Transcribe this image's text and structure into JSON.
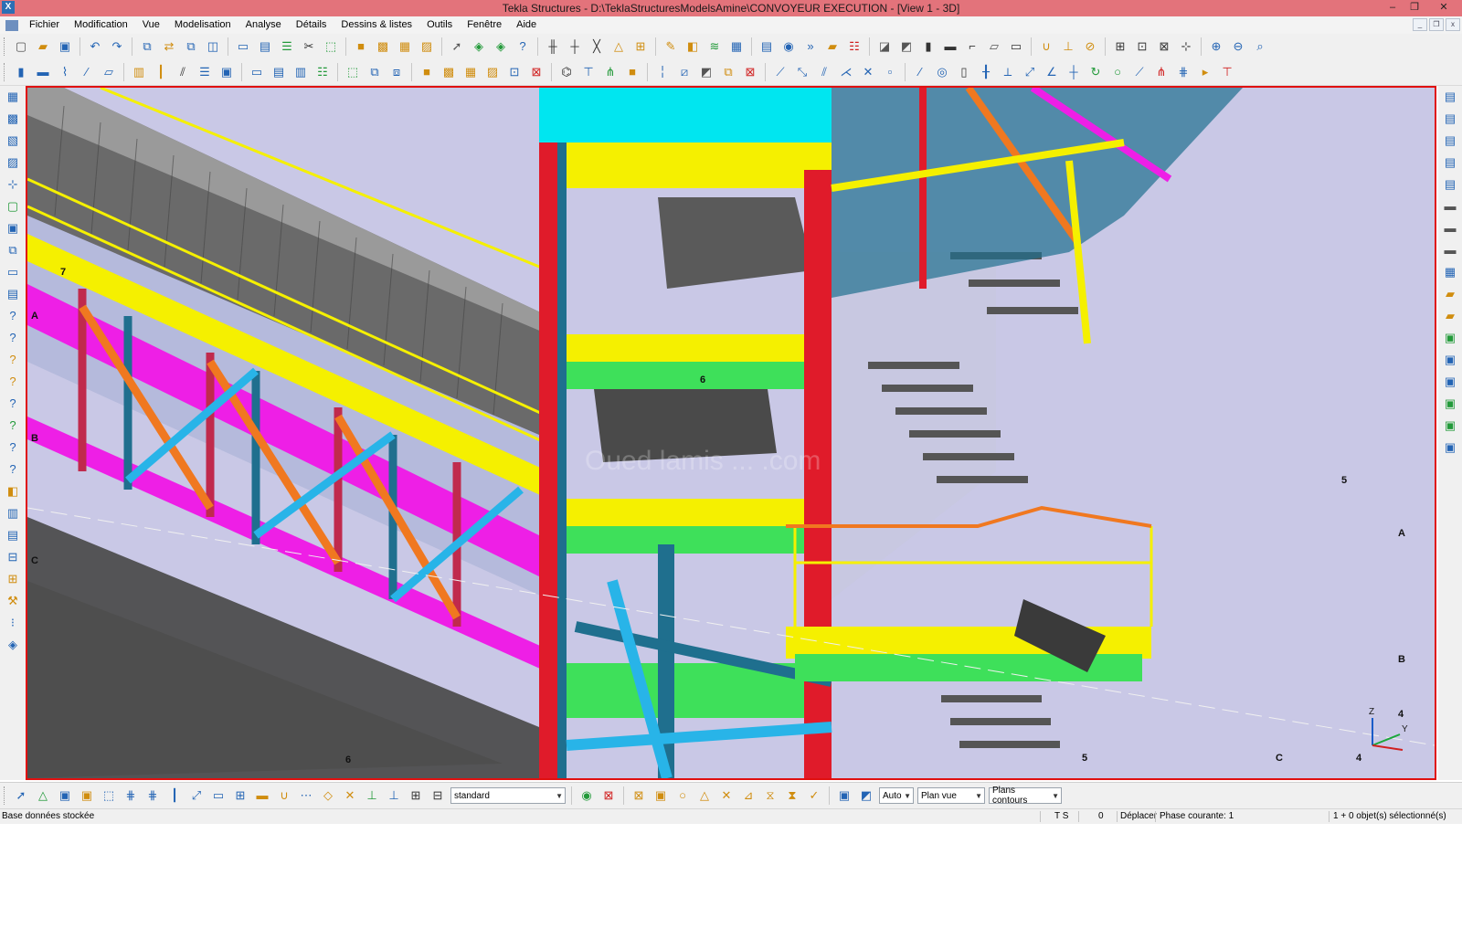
{
  "window": {
    "title": "Tekla Structures - D:\\TeklaStructuresModelsAmine\\CONVOYEUR EXECUTION - [View 1 - 3D]",
    "controls": [
      "–",
      "❐",
      "✕"
    ]
  },
  "menu": {
    "items": [
      "Fichier",
      "Modification",
      "Vue",
      "Modelisation",
      "Analyse",
      "Détails",
      "Dessins & listes",
      "Outils",
      "Fenêtre",
      "Aide"
    ]
  },
  "viewport": {
    "border_color": "#e01010",
    "background": "#c9c8e6",
    "watermark": "Oued lamis ... .com",
    "grid_labels": [
      {
        "id": "gl-7",
        "text": "7"
      },
      {
        "id": "gl-a-left",
        "text": "A"
      },
      {
        "id": "gl-b-left",
        "text": "B"
      },
      {
        "id": "gl-c-left",
        "text": "C"
      },
      {
        "id": "gl-6-top",
        "text": "6"
      },
      {
        "id": "gl-6-bottom",
        "text": "6"
      },
      {
        "id": "gl-5-right",
        "text": "5"
      },
      {
        "id": "gl-a-right",
        "text": "A"
      },
      {
        "id": "gl-b-right",
        "text": "B"
      },
      {
        "id": "gl-4-right",
        "text": "4"
      },
      {
        "id": "gl-5-bottom",
        "text": "5"
      },
      {
        "id": "gl-c-bottom",
        "text": "C"
      },
      {
        "id": "gl-4-bottom",
        "text": "4"
      }
    ],
    "axes": {
      "z": "Z",
      "y": "Y",
      "x": "X"
    }
  },
  "bottom_toolbar": {
    "select_filter": "standard",
    "snap_mode": "Auto",
    "plane": "Plan vue",
    "depth": "Plans contours"
  },
  "status": {
    "left": "Base données stockée",
    "ts": "T S",
    "value": "0",
    "mode": "Déplacer",
    "phase": "Phase courante: 1",
    "selection": "1 + 0 objet(s) sélectionné(s)"
  }
}
